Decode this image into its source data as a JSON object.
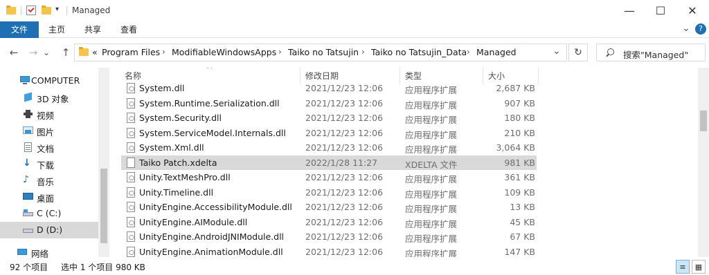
{
  "window": {
    "title": "Managed",
    "minimize": "—",
    "maximize": "☐",
    "close": "✕"
  },
  "ribbon": {
    "tabs": [
      "文件",
      "主页",
      "共享",
      "查看"
    ],
    "expand_chevron": "⌄",
    "help": "?"
  },
  "nav": {
    "back": "←",
    "forward": "→",
    "recent": "⌄",
    "up": "↑"
  },
  "address": {
    "overflow": "«",
    "crumbs": [
      "Program Files",
      "ModifiableWindowsApps",
      "Taiko no Tatsujin",
      "Taiko no Tatsujin_Data",
      "Managed"
    ],
    "separator": "›",
    "dropdown": "⌄",
    "refresh": "↻"
  },
  "search": {
    "placeholder": "搜索\"Managed\""
  },
  "sidebar": {
    "items": [
      {
        "label": "COMPUTER",
        "icon": "computer-icon"
      },
      {
        "label": "3D 对象",
        "icon": "3d-objects-icon"
      },
      {
        "label": "视频",
        "icon": "video-icon"
      },
      {
        "label": "图片",
        "icon": "pictures-icon"
      },
      {
        "label": "文档",
        "icon": "documents-icon"
      },
      {
        "label": "下载",
        "icon": "download-icon"
      },
      {
        "label": "音乐",
        "icon": "music-icon"
      },
      {
        "label": "桌面",
        "icon": "desktop-icon"
      },
      {
        "label": "C (C:)",
        "icon": "drive-icon"
      },
      {
        "label": "D (D:)",
        "icon": "drive-icon",
        "selected": true
      },
      {
        "label": "网络",
        "icon": "network-icon"
      }
    ]
  },
  "filelist": {
    "columns": [
      "名称",
      "修改日期",
      "类型",
      "大小"
    ],
    "rows": [
      {
        "name": "System.dll",
        "date": "2021/12/23 12:06",
        "type": "应用程序扩展",
        "size": "2,687 KB"
      },
      {
        "name": "System.Runtime.Serialization.dll",
        "date": "2021/12/23 12:06",
        "type": "应用程序扩展",
        "size": "907 KB"
      },
      {
        "name": "System.Security.dll",
        "date": "2021/12/23 12:06",
        "type": "应用程序扩展",
        "size": "180 KB"
      },
      {
        "name": "System.ServiceModel.Internals.dll",
        "date": "2021/12/23 12:06",
        "type": "应用程序扩展",
        "size": "210 KB"
      },
      {
        "name": "System.Xml.dll",
        "date": "2021/12/23 12:06",
        "type": "应用程序扩展",
        "size": "3,064 KB"
      },
      {
        "name": "Taiko Patch.xdelta",
        "date": "2022/1/28 11:27",
        "type": "XDELTA 文件",
        "size": "981 KB",
        "selected": true
      },
      {
        "name": "Unity.TextMeshPro.dll",
        "date": "2021/12/23 12:06",
        "type": "应用程序扩展",
        "size": "361 KB"
      },
      {
        "name": "Unity.Timeline.dll",
        "date": "2021/12/23 12:06",
        "type": "应用程序扩展",
        "size": "109 KB"
      },
      {
        "name": "UnityEngine.AccessibilityModule.dll",
        "date": "2021/12/23 12:06",
        "type": "应用程序扩展",
        "size": "13 KB"
      },
      {
        "name": "UnityEngine.AIModule.dll",
        "date": "2021/12/23 12:06",
        "type": "应用程序扩展",
        "size": "45 KB"
      },
      {
        "name": "UnityEngine.AndroidJNIModule.dll",
        "date": "2021/12/23 12:06",
        "type": "应用程序扩展",
        "size": "67 KB"
      },
      {
        "name": "UnityEngine.AnimationModule.dll",
        "date": "2021/12/23 12:06",
        "type": "应用程序扩展",
        "size": "147 KB"
      }
    ]
  },
  "status": {
    "item_count": "92 个项目",
    "selection": "选中 1 个项目  980 KB"
  },
  "colors": {
    "accent": "#1f6fb5",
    "selected_row": "#d9d9d9",
    "folder": "#f4c44c"
  }
}
